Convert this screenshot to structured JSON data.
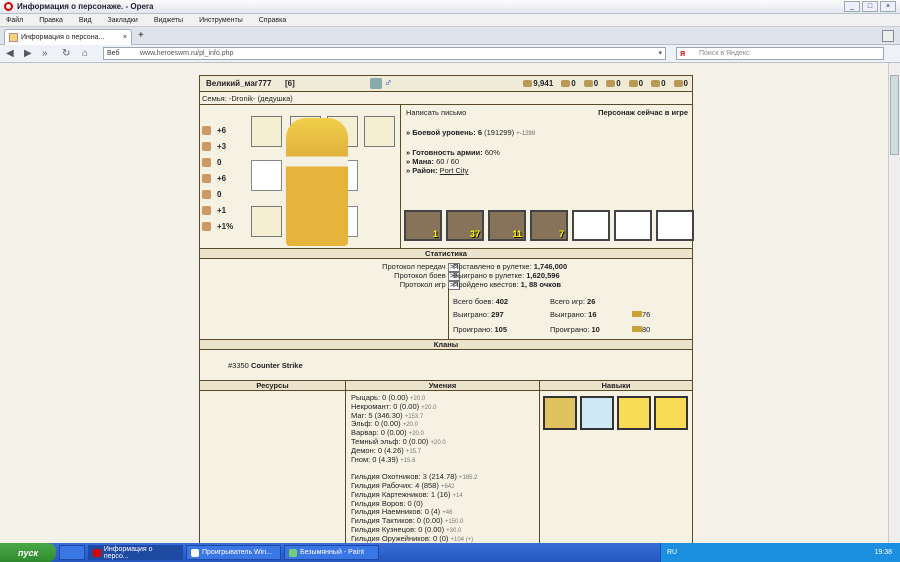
{
  "window": {
    "title": "Информация о персонаже. - Opera"
  },
  "menu": [
    "Файл",
    "Правка",
    "Вид",
    "Закладки",
    "Виджеты",
    "Инструменты",
    "Справка"
  ],
  "tab": {
    "label": "Информация о персона...",
    "close": "×",
    "new": "+"
  },
  "address": {
    "prefix": "Веб",
    "url": "www.heroeswm.ru/pl_info.php",
    "search_placeholder": "Поиск в Яндекс"
  },
  "header": {
    "name": "Великий_маг777",
    "level": "[6]",
    "resources": [
      "9,941",
      "0",
      "0",
      "0",
      "0",
      "0",
      "0"
    ]
  },
  "clan_line": "Семья: -Dronik- (дедушка)",
  "stats": [
    "+6",
    "+3",
    "0",
    "+6",
    "0",
    "+1",
    "+1%"
  ],
  "info": {
    "write": "Написать письмо",
    "online": "Персонаж сейчас в игре",
    "combat_label": "» Боевой уровень:",
    "combat_value": "6",
    "combat_exp": "(191299)",
    "combat_delta": "+-1299",
    "army_label": "» Готовность армии:",
    "army_value": "60%",
    "mana_label": "» Мана:",
    "mana_value": "60 / 60",
    "district_label": "» Район:",
    "district_value": "Port City"
  },
  "army": [
    "1",
    "37",
    "11",
    "7"
  ],
  "statistics": {
    "title": "Статистика",
    "protocols": [
      "Протокол передач",
      ">>",
      "Протокол боев",
      ">>",
      "Протокол игр",
      ">>"
    ],
    "roulette_bet_label": "Поставлено в рулетке:",
    "roulette_bet": "1,746,000",
    "roulette_win_label": "Выиграно в рулетке:",
    "roulette_win": "1,620,596",
    "quests_label": "Пройдено квестов:",
    "quests": "1, 88 очков",
    "battles_total_label": "Всего боев:",
    "battles_total": "402",
    "battles_won_label": "Выиграно:",
    "battles_won": "297",
    "battles_lost_label": "Проиграно:",
    "battles_lost": "105",
    "games_total_label": "Всего игр:",
    "games_total": "26",
    "games_won_label": "Выиграно:",
    "games_won": "16",
    "games_lost_label": "Проиграно:",
    "games_lost": "10",
    "gold_won": "76",
    "gold_lost": "80"
  },
  "clans": {
    "title": "Кланы",
    "id": "#3350",
    "name": "Counter Strike"
  },
  "columns": {
    "resources": "Ресурсы",
    "skills": "Умения",
    "talents": "Навыки"
  },
  "skills": [
    {
      "t": "Рыцарь: 0 (0.00)",
      "s": "+20.0"
    },
    {
      "t": "Некромант: 0 (0.00)",
      "s": "+20.0"
    },
    {
      "t": "Маг: 5 (346.30)",
      "s": "+153.7"
    },
    {
      "t": "Эльф: 0 (0.00)",
      "s": "+20.0"
    },
    {
      "t": "Варвар: 0 (0.00)",
      "s": "+20.0"
    },
    {
      "t": "Темный эльф: 0 (0.00)",
      "s": "+20.0"
    },
    {
      "t": "Демон: 0 (4.26)",
      "s": "+15.7"
    },
    {
      "t": "Гном: 0 (4.39)",
      "s": "+15.6"
    },
    {
      "t": "",
      "s": ""
    },
    {
      "t": "Гильдия Охотников: 3 (214.78)",
      "s": "+185.2"
    },
    {
      "t": "Гильдия Рабочих: 4 (858)",
      "s": "+642"
    },
    {
      "t": "Гильдия Картежников: 1 (16)",
      "s": "+14"
    },
    {
      "t": "Гильдия Воров: 0 (0)",
      "s": ""
    },
    {
      "t": "Гильдия Наемников: 0 (4)",
      "s": "+46"
    },
    {
      "t": "Гильдия Тактиков: 0 (0.00)",
      "s": "+150.0"
    },
    {
      "t": "Гильдия Кузнецов: 0 (0.00)",
      "s": "+30.0"
    },
    {
      "t": "Гильдия Оружейников: 0 (0)",
      "s": "+104 (+)"
    }
  ],
  "taskbar": {
    "start": "пуск",
    "items": [
      "Информация о персо...",
      "Проигрыватель Win...",
      "Безымянный - Paint"
    ],
    "lang": "RU",
    "time": "19:38"
  }
}
